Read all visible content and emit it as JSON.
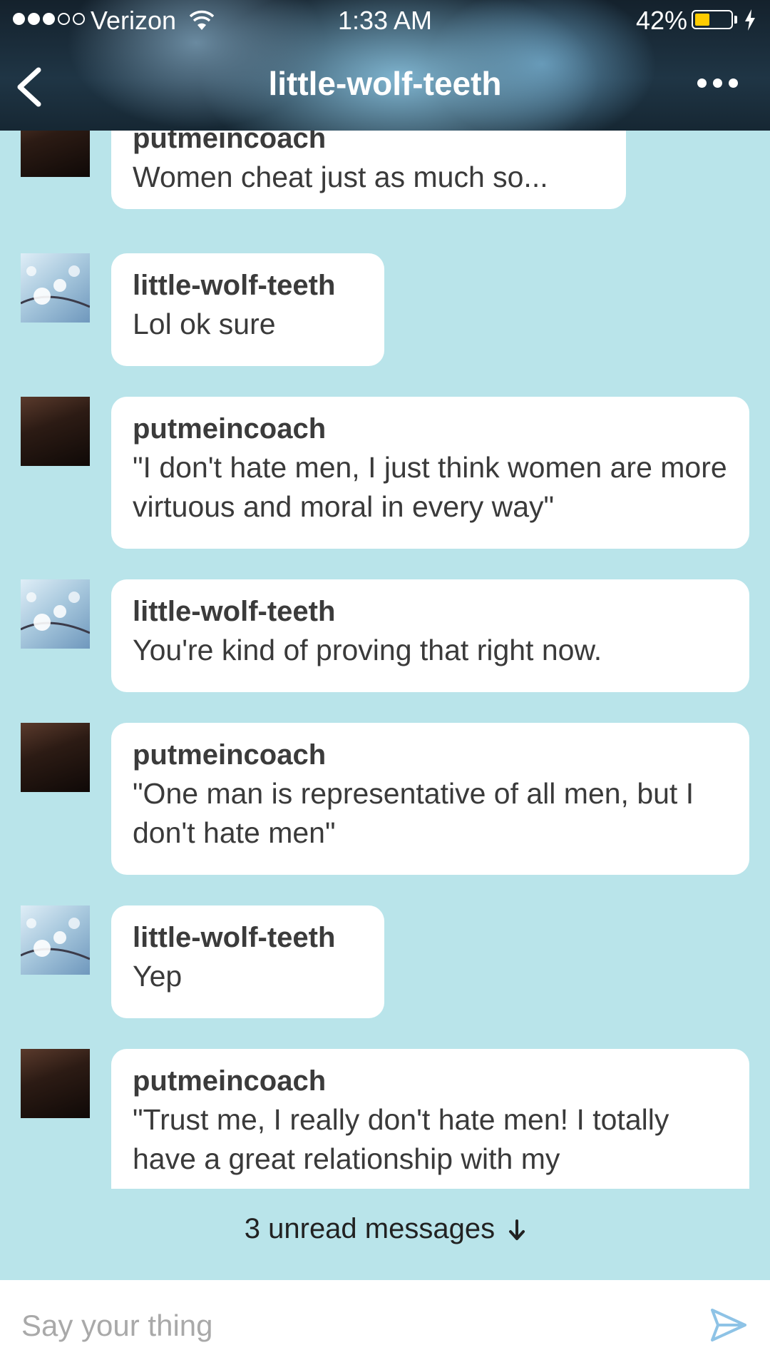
{
  "status_bar": {
    "carrier": "Verizon",
    "time": "1:33 AM",
    "battery_percent": "42%",
    "battery_level": 0.42,
    "signal_bars": 3,
    "signal_total": 5
  },
  "header": {
    "title": "little-wolf-teeth",
    "back_icon": "chevron-left-icon",
    "more_icon": "more-dots-icon"
  },
  "messages": [
    {
      "sender": "putmeincoach",
      "text": "Women cheat just as much so...",
      "avatar": "man-avatar"
    },
    {
      "sender": "little-wolf-teeth",
      "text": "Lol ok sure",
      "avatar": "flower-avatar"
    },
    {
      "sender": "putmeincoach",
      "text": "\"I don't hate men, I just think women are more virtuous and moral in every way\"",
      "avatar": "man-avatar"
    },
    {
      "sender": "little-wolf-teeth",
      "text": "You're kind of proving that right now.",
      "avatar": "flower-avatar"
    },
    {
      "sender": "putmeincoach",
      "text": "\"One man is representative of all men, but I don't hate men\"",
      "avatar": "man-avatar"
    },
    {
      "sender": "little-wolf-teeth",
      "text": "Yep",
      "avatar": "flower-avatar"
    },
    {
      "sender": "putmeincoach",
      "text": "\"Trust me, I really don't hate men! I totally have a great relationship with my",
      "avatar": "man-avatar"
    }
  ],
  "unread_banner": {
    "label": "3 unread messages"
  },
  "composer": {
    "placeholder": "Say your thing"
  },
  "colors": {
    "background": "#b9e4ea",
    "bubble": "#ffffff",
    "battery": "#ffcc00",
    "send_icon": "#8ec3e6"
  }
}
